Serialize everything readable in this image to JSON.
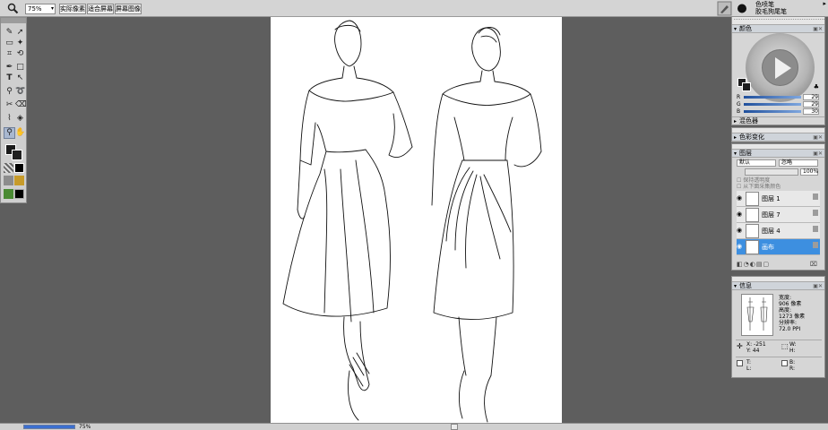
{
  "toolbar": {
    "tool_icon": "zoom-icon",
    "zoom_value": "75%",
    "buttons": [
      "实际像素",
      "适合屏幕",
      "屏幕图像"
    ],
    "brush_name_line1": "色喷笔",
    "brush_name_line2": "胶毛狗尾笔"
  },
  "tools_panel": {
    "text_tool": "T"
  },
  "color_panel": {
    "title": "颜色",
    "r_label": "R",
    "r_value": "29",
    "g_label": "G",
    "g_value": "29",
    "b_label": "B",
    "b_value": "30",
    "mixer_label": "混色器",
    "variation_label": "色彩变化"
  },
  "layers_panel": {
    "title": "图层",
    "blend_mode": "默认",
    "composite": "忽略",
    "opacity": "100%",
    "preserve_transparency": "保持透明度",
    "pick_up_underlying": "从下面采集颜色",
    "layers": [
      {
        "name": "图层 1"
      },
      {
        "name": "图层 7"
      },
      {
        "name": "图层 4"
      },
      {
        "name": "画布"
      }
    ]
  },
  "info_panel": {
    "title": "信息",
    "width_label": "宽度:",
    "width_value": "906 像素",
    "height_label": "高度:",
    "height_value": "1273 像素",
    "res_label": "分辨率:",
    "res_value": "72.0 PPI",
    "x_coord": "X: -251",
    "y_coord": "Y: 44",
    "w_label": "W:",
    "h_label": "H:",
    "t_label": "T:",
    "l_label": "L:",
    "b_label": "B:",
    "r_label": "R:"
  },
  "status": {
    "zoom": "75%"
  },
  "colors": {
    "selected_layer": "#3d8fe0",
    "background": "#5e5e5e"
  }
}
